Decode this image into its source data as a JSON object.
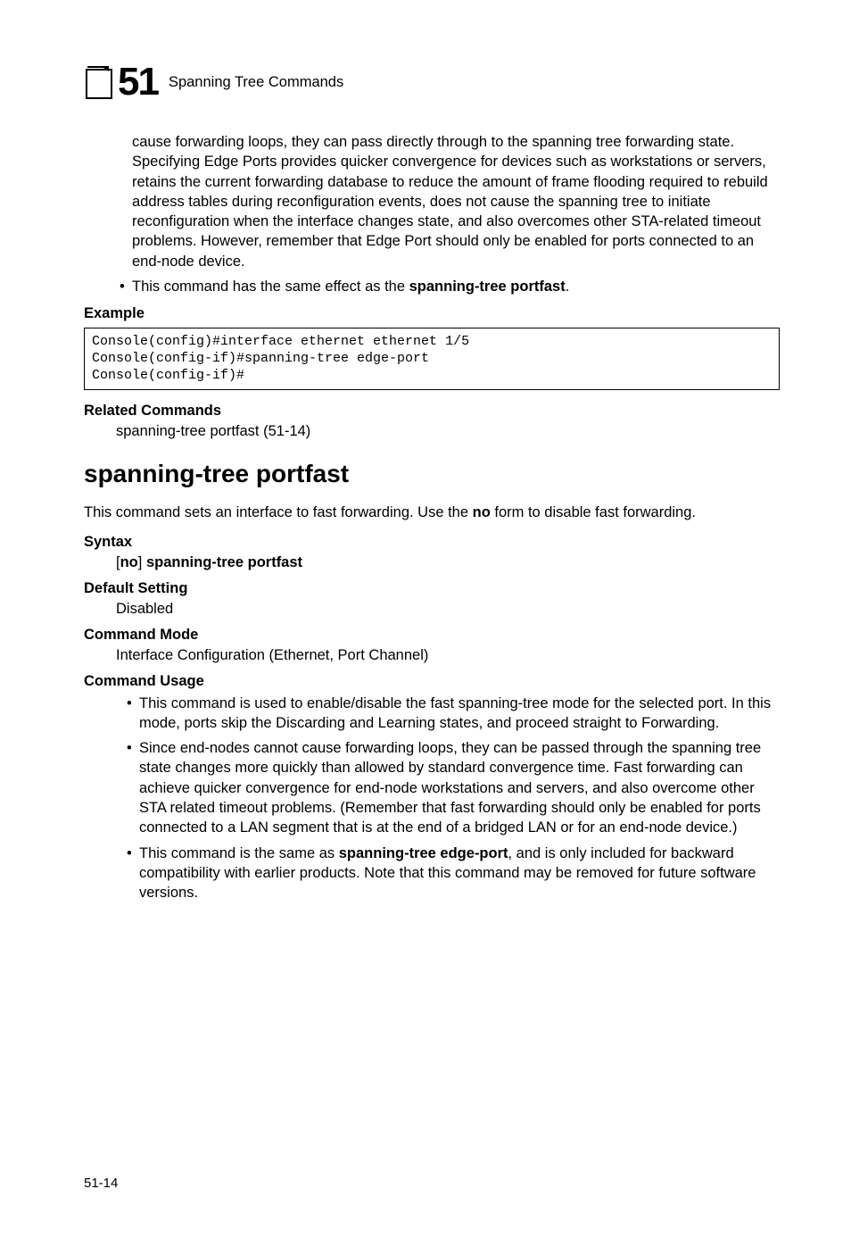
{
  "header": {
    "chapter_number": "51",
    "chapter_title": "Spanning Tree Commands"
  },
  "top_para": "cause forwarding loops, they can pass directly through to the spanning tree forwarding state. Specifying Edge Ports provides quicker convergence for devices such as workstations or servers, retains the current forwarding database to reduce the amount of frame flooding required to rebuild address tables during reconfiguration events, does not cause the spanning tree to initiate reconfiguration when the interface changes state, and also overcomes other STA-related timeout problems. However, remember that Edge Port should only be enabled for ports connected to an end-node device.",
  "top_bullet_pre": "This command has the same effect as the ",
  "top_bullet_bold": "spanning-tree portfast",
  "top_bullet_post": ".",
  "example_label": "Example",
  "code": "Console(config)#interface ethernet ethernet 1/5\nConsole(config-if)#spanning-tree edge-port\nConsole(config-if)#",
  "related_label": "Related Commands",
  "related_item": "spanning-tree portfast (51-14)",
  "section_title": "spanning-tree portfast",
  "intro_pre": "This command sets an interface to fast forwarding. Use the ",
  "intro_bold": "no",
  "intro_post": " form to disable fast forwarding.",
  "syntax_label": "Syntax",
  "syntax_open": "[",
  "syntax_no": "no",
  "syntax_close": "] ",
  "syntax_cmd": "spanning-tree portfast",
  "default_label": "Default Setting",
  "default_value": "Disabled",
  "mode_label": "Command Mode",
  "mode_value": "Interface Configuration (Ethernet, Port Channel)",
  "usage_label": "Command Usage",
  "usage_bullets": {
    "b1": "This command is used to enable/disable the fast spanning-tree mode for the selected port. In this mode, ports skip the Discarding and Learning states, and proceed straight to Forwarding.",
    "b2": "Since end-nodes cannot cause forwarding loops, they can be passed through the spanning tree state changes more quickly than allowed by standard convergence time. Fast forwarding can achieve quicker convergence for end-node workstations and servers, and also overcome other STA related timeout problems. (Remember that fast forwarding should only be enabled for ports connected to a LAN segment that is at the end of a bridged LAN or for an end-node device.)",
    "b3_pre": "This command is the same as ",
    "b3_bold": "spanning-tree edge-port",
    "b3_post": ", and is only included for backward compatibility with earlier products. Note that this command may be removed for future software versions."
  },
  "page_number": "51-14"
}
